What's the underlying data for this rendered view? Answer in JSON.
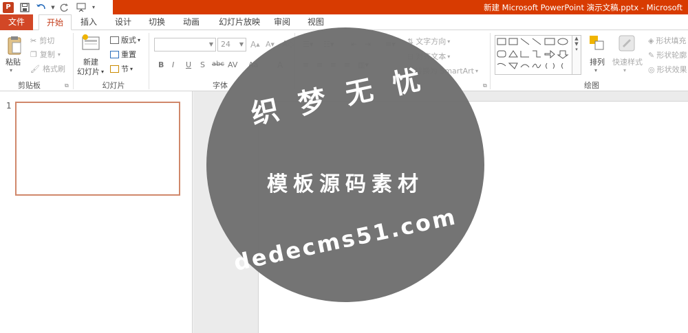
{
  "window": {
    "title": "新建 Microsoft PowerPoint 演示文稿.pptx - Microsoft"
  },
  "quick_access": {
    "icons": [
      "powerpoint-logo-icon",
      "save-icon",
      "undo-icon",
      "redo-icon",
      "presentation-icon",
      "customize-qat-icon"
    ]
  },
  "tabs": [
    {
      "label": "文件"
    },
    {
      "label": "开始"
    },
    {
      "label": "插入"
    },
    {
      "label": "设计"
    },
    {
      "label": "切换"
    },
    {
      "label": "动画"
    },
    {
      "label": "幻灯片放映"
    },
    {
      "label": "审阅"
    },
    {
      "label": "视图"
    }
  ],
  "clipboard": {
    "paste": "粘贴",
    "cut": "剪切",
    "copy": "复制",
    "format_painter": "格式刷",
    "group": "剪贴板"
  },
  "slides": {
    "new_slide_line1": "新建",
    "new_slide_line2": "幻灯片",
    "layout": "版式",
    "reset": "重置",
    "section": "节",
    "group": "幻灯片"
  },
  "font": {
    "size": "24",
    "bold": "B",
    "italic": "I",
    "underline": "U",
    "shadow": "S",
    "strike": "abc",
    "spacing": "AV",
    "case": "Aa",
    "color": "A",
    "group": "字体"
  },
  "paragraph": {
    "text_direction": "文字方向",
    "align_text": "对齐文本",
    "smartart": "转换为 SmartArt"
  },
  "drawing": {
    "arrange": "排列",
    "quick_styles": "快速样式",
    "shape_fill": "形状填充",
    "shape_outline": "形状轮廓",
    "shape_effects": "形状效果",
    "group": "绘图"
  },
  "thumbnail": {
    "number": "1"
  },
  "watermark": {
    "title": "织梦无忧",
    "subtitle": "模板源码素材",
    "url": "dedecms51.com"
  },
  "colors": {
    "accent": "#d24726",
    "title_bar": "#d83b01",
    "thumb_border": "#d0876a"
  }
}
